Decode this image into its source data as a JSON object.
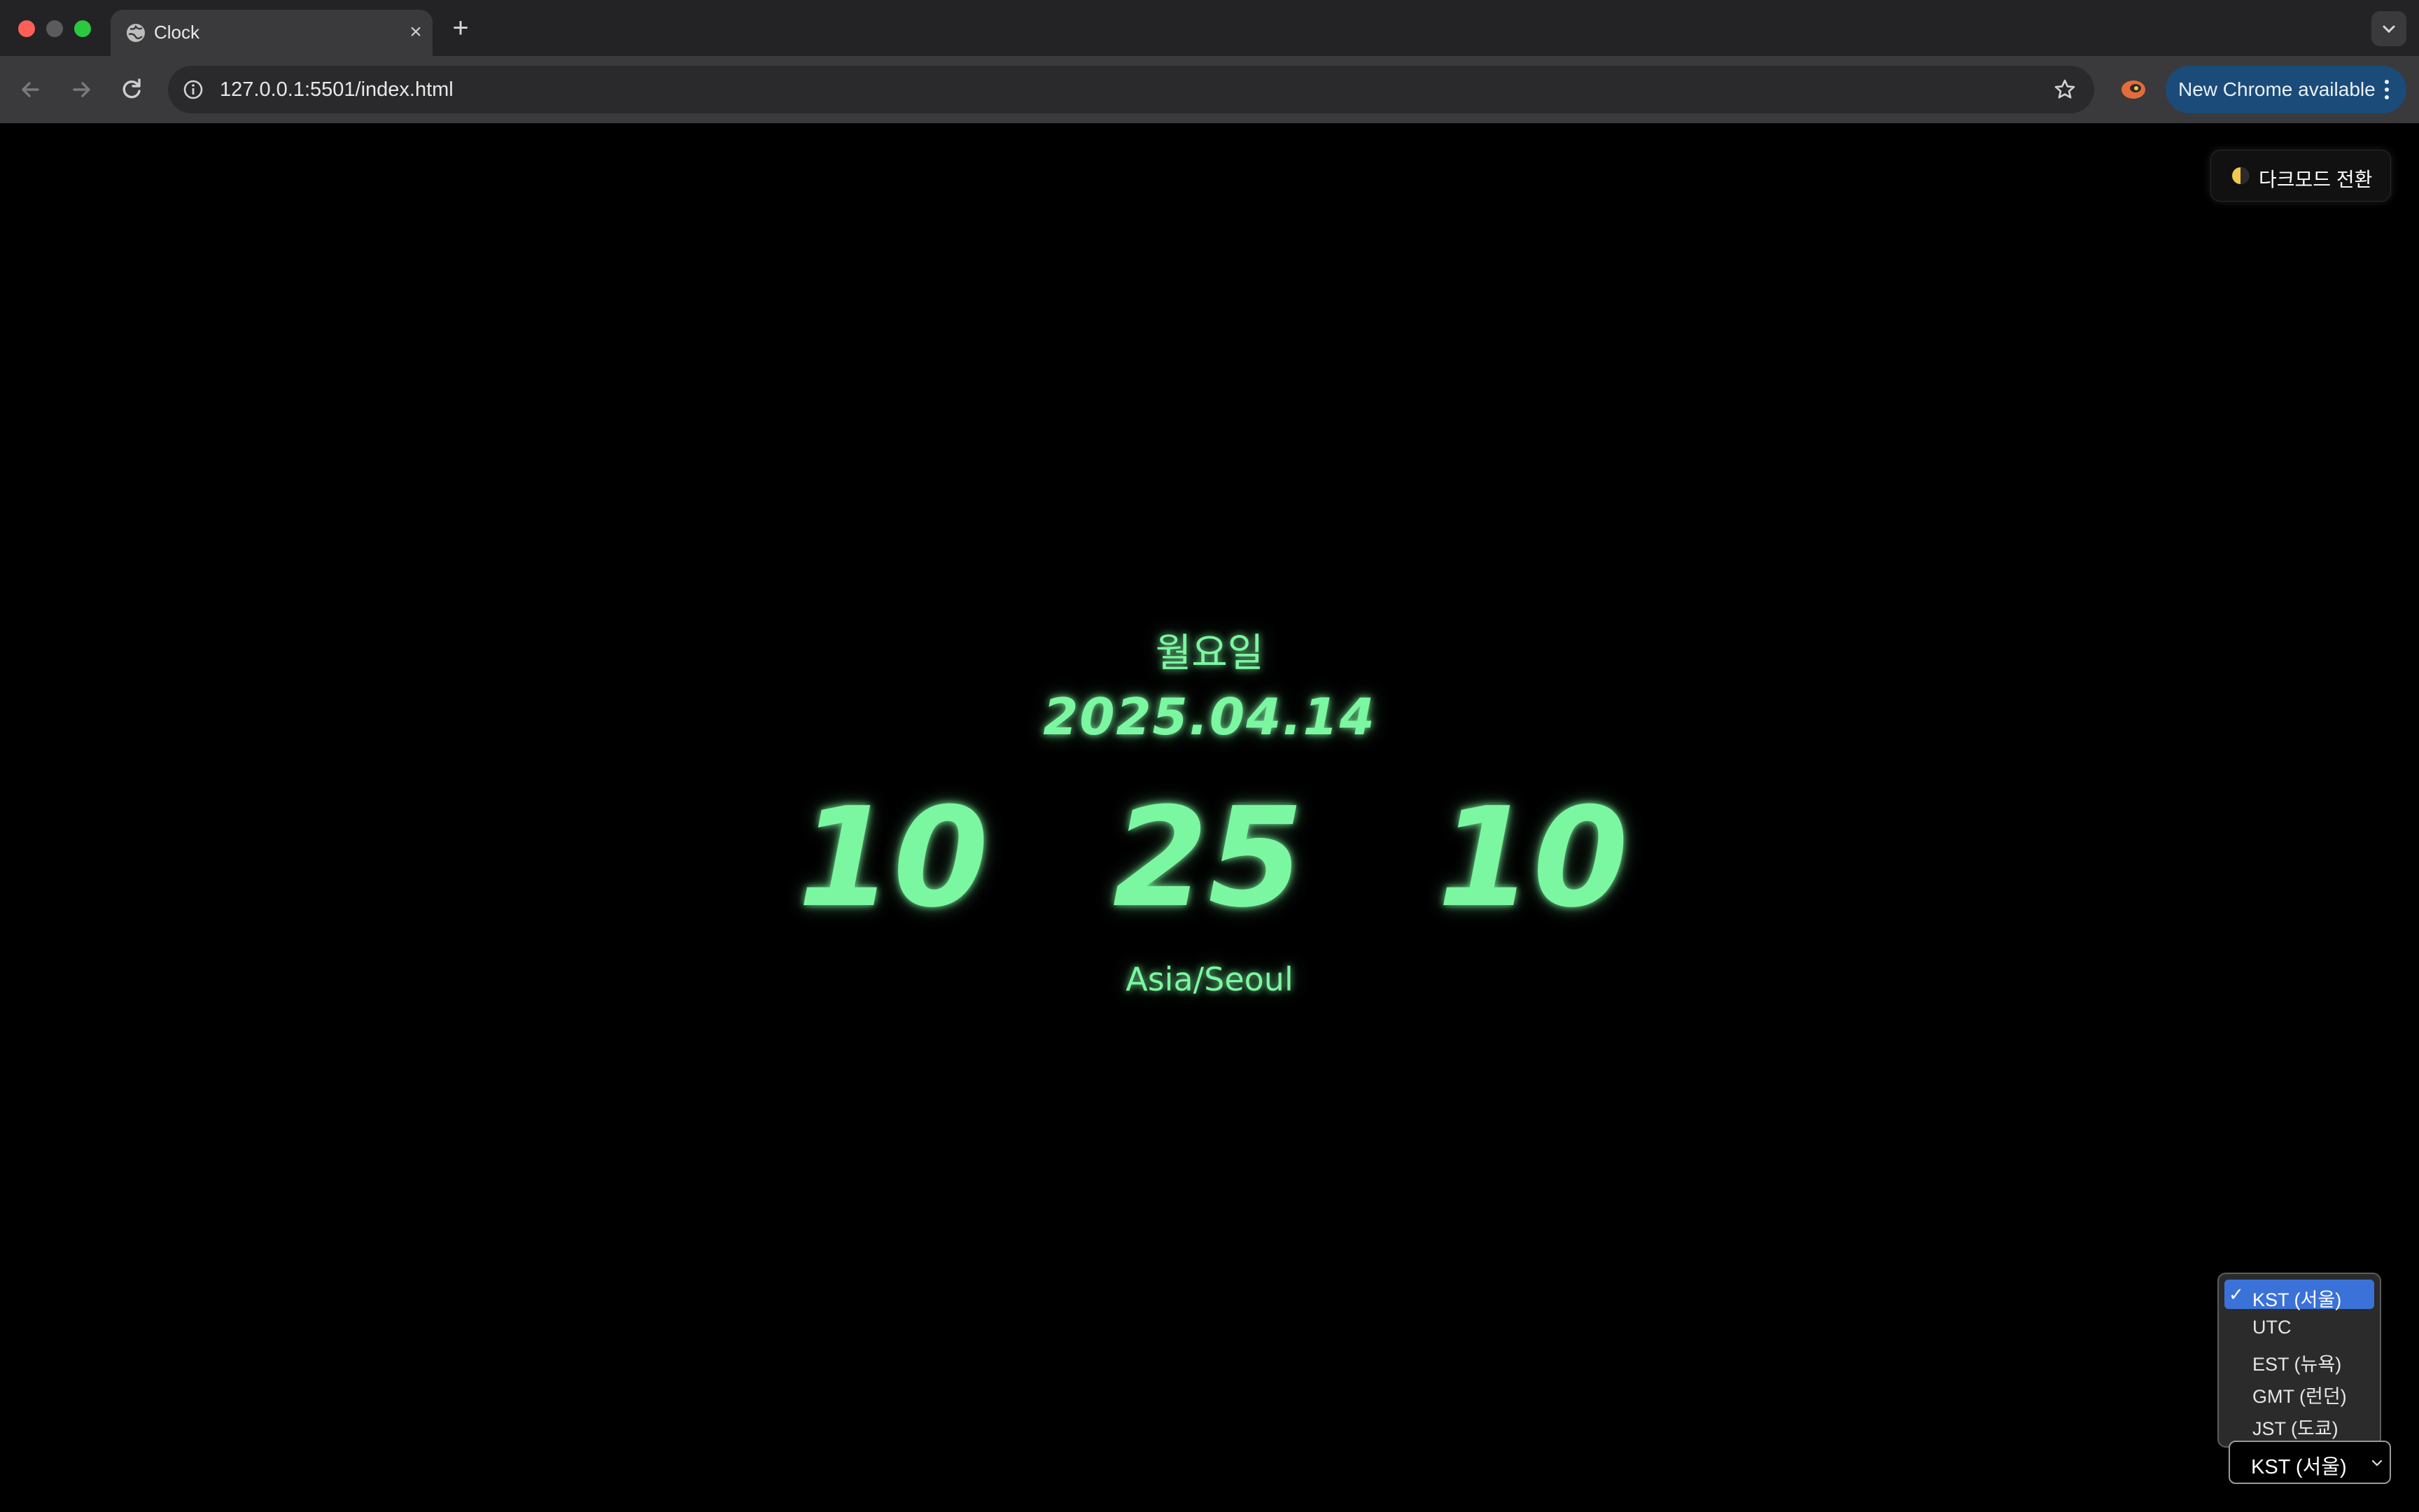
{
  "browser": {
    "tab_title": "Clock",
    "new_tab_symbol": "+",
    "close_symbol": "×",
    "url": "127.0.0.1:5501/index.html",
    "update_label": "New Chrome available",
    "icons": [
      "globe-icon",
      "close-icon",
      "plus-icon",
      "chevron-down-icon",
      "back-icon",
      "forward-icon",
      "reload-icon",
      "info-icon",
      "star-icon",
      "extension-icon",
      "kebab-menu-icon"
    ]
  },
  "page": {
    "theme_toggle": {
      "icon": "half-moon-icon",
      "label": "다크모드 전환"
    },
    "weekday": "월요일",
    "date": "2025.04.14",
    "time": {
      "hours": "10",
      "minutes": "25",
      "seconds": "10"
    },
    "timezone": "Asia/Seoul",
    "accent_color": "#7cf7a1",
    "background_color": "#000000"
  },
  "timezone_select": {
    "selected_label": "KST (서울)",
    "check_mark": "✓",
    "options": [
      {
        "label": "KST (서울)",
        "selected": true
      },
      {
        "label": "UTC",
        "selected": false
      },
      {
        "label": "EST (뉴욕)",
        "selected": false
      },
      {
        "label": "GMT (런던)",
        "selected": false
      },
      {
        "label": "JST (도쿄)",
        "selected": false
      }
    ]
  }
}
